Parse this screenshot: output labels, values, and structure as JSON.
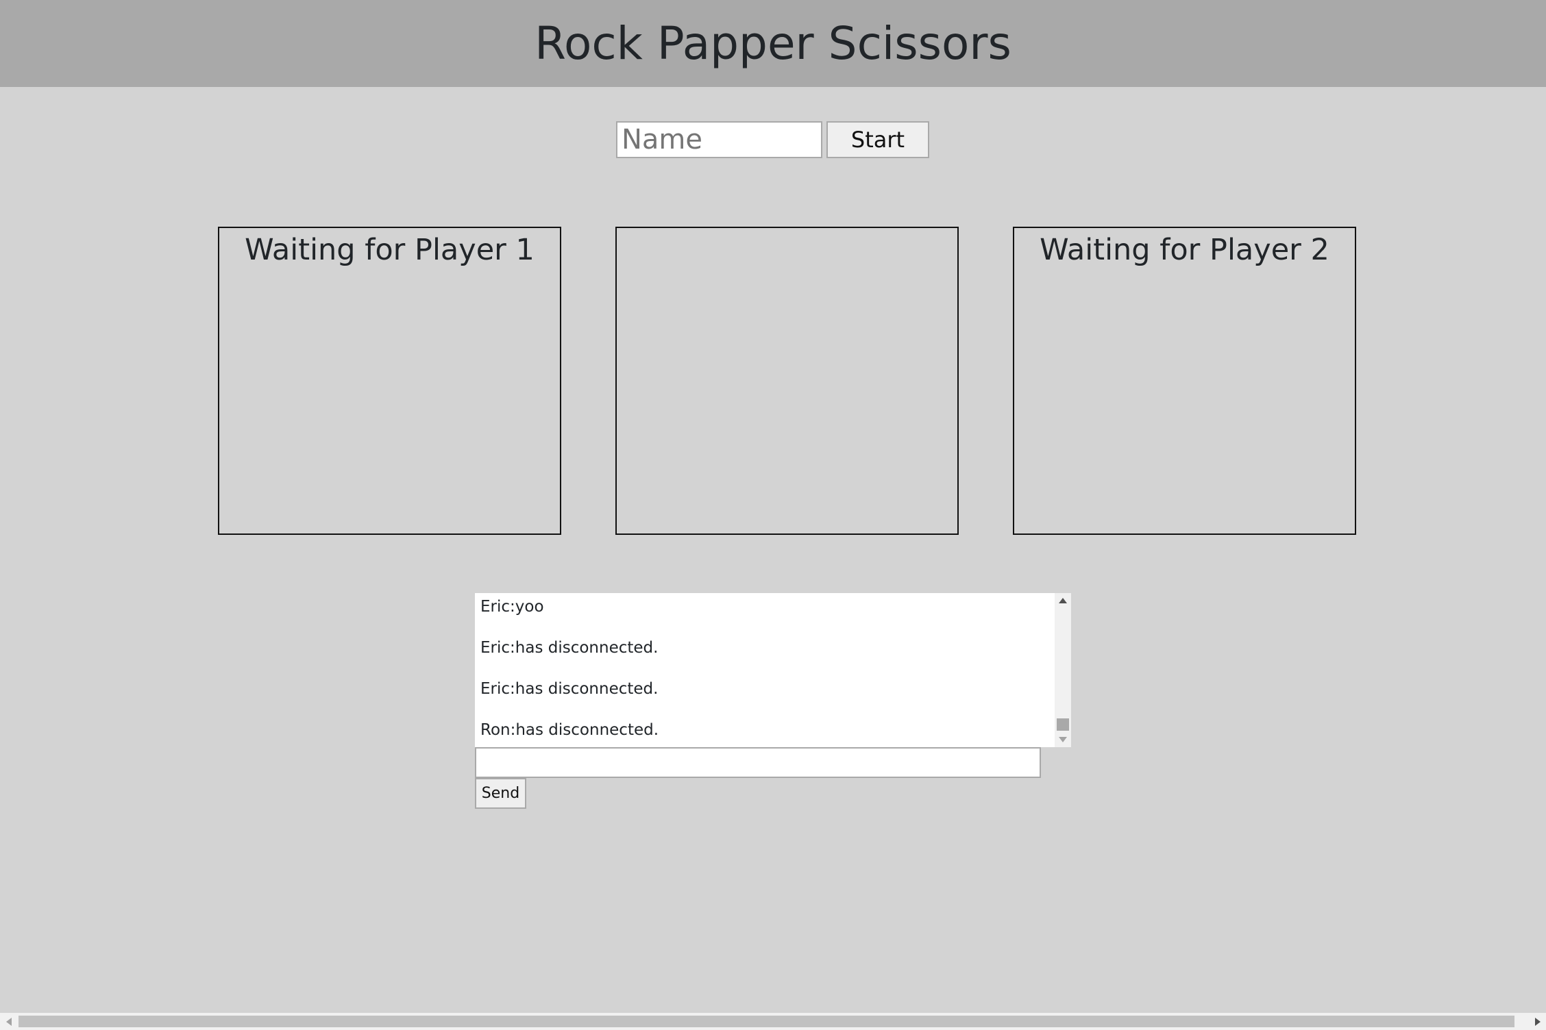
{
  "header": {
    "title": "Rock Papper Scissors"
  },
  "join": {
    "name_placeholder": "Name",
    "name_value": "",
    "start_label": "Start"
  },
  "game": {
    "player1_status": "Waiting for Player 1",
    "center_status": "",
    "player2_status": "Waiting for Player 2"
  },
  "chat": {
    "messages": [
      "Eric:yoo",
      "Eric:has disconnected.",
      "Eric:has disconnected.",
      "Ron:has disconnected."
    ],
    "input_value": "",
    "send_label": "Send"
  },
  "colors": {
    "header_bg": "#a9a9a9",
    "page_bg": "#d3d3d3"
  },
  "icons": {
    "scroll_up": "triangle-up-icon",
    "scroll_down": "triangle-down-icon",
    "scroll_left": "triangle-left-icon",
    "scroll_right": "triangle-right-icon"
  }
}
